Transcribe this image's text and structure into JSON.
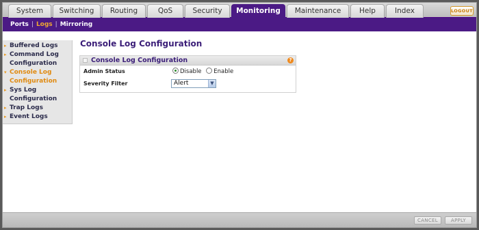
{
  "tabs": [
    {
      "label": "System"
    },
    {
      "label": "Switching"
    },
    {
      "label": "Routing"
    },
    {
      "label": "QoS"
    },
    {
      "label": "Security"
    },
    {
      "label": "Monitoring"
    },
    {
      "label": "Maintenance"
    },
    {
      "label": "Help"
    },
    {
      "label": "Index"
    }
  ],
  "active_tab": "Monitoring",
  "logout_label": "LOGOUT",
  "subnav": {
    "items": [
      {
        "label": "Ports"
      },
      {
        "label": "Logs"
      },
      {
        "label": "Mirroring"
      }
    ],
    "active": "Logs",
    "separator": "|"
  },
  "sidebar": {
    "items": [
      {
        "label": "Buffered Logs"
      },
      {
        "label": "Command Log Configuration"
      },
      {
        "label": "Console Log Configuration"
      },
      {
        "label": "Sys Log Configuration"
      },
      {
        "label": "Trap Logs"
      },
      {
        "label": "Event Logs"
      }
    ],
    "active": "Console Log Configuration"
  },
  "page_title": "Console Log Configuration",
  "panel": {
    "title": "Console Log Configuration",
    "help_glyph": "?",
    "admin_status": {
      "label": "Admin Status",
      "options": [
        "Disable",
        "Enable"
      ],
      "selected": "Disable"
    },
    "severity_filter": {
      "label": "Severity Filter",
      "value": "Alert"
    }
  },
  "buttons": {
    "cancel": "CANCEL",
    "apply": "APPLY"
  },
  "colors": {
    "accent": "#4b1a85",
    "highlight": "#e08a10"
  }
}
